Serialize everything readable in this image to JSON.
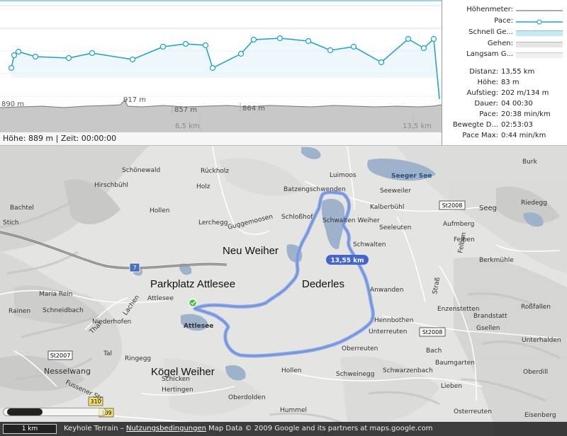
{
  "profile": {
    "elevation_labels": [
      "890 m",
      "917 m",
      "857 m",
      "864 m"
    ],
    "distance_labels": [
      "6,5 km",
      "13,5 km"
    ],
    "status": "Höhe: 889 m | Zeit: 00:00:00",
    "colors": {
      "pace": "#1ea0c8",
      "pace_fill": "#c8e8f4",
      "elevation": "#888888"
    }
  },
  "legend": {
    "items": [
      {
        "label": "Höhenmeter:",
        "swatch": "line-gray"
      },
      {
        "label": "Pace:",
        "swatch": "line-dot-blue"
      },
      {
        "label": "Schnell Ge...",
        "swatch": "fill-lightblue"
      },
      {
        "label": "Gehen:",
        "swatch": "fill-gray"
      },
      {
        "label": "Langsam G...",
        "swatch": "fill-lightgray"
      }
    ]
  },
  "stats": [
    {
      "key": "Distanz:",
      "value": "13,55 km"
    },
    {
      "key": "Höhe:",
      "value": "83 m"
    },
    {
      "key": "Aufstieg:",
      "value": "202 m/134 m"
    },
    {
      "key": "Dauer:",
      "value": "04 00:30"
    },
    {
      "key": "Pace:",
      "value": "20:38 min/km"
    },
    {
      "key": "Bewegte D...",
      "value": "02:53:03"
    },
    {
      "key": "Pace Max:",
      "value": "0:44 min/km"
    }
  ],
  "map": {
    "places": {
      "schoenewald": "Schönewald",
      "rueckholz": "Rückholz",
      "hirschbuehl": "Hirschbühl",
      "holz": "Holz",
      "luimoos": "Luimoos",
      "seeger_see": "Seeger See",
      "burk": "Burk",
      "batzengschwenden": "Batzengschwenden",
      "seeweiler": "Seeweiler",
      "bachtel": "Bachtel",
      "hollen": "Hollen",
      "kalberbuehl": "Kalberbühl",
      "seeg": "Seeg",
      "riedegg": "Riedegg",
      "stich": "Stich",
      "lerchegg": "Lerchegg",
      "guggemoosen": "Guggemoosen",
      "schlosshof": "Schloßhof",
      "schwarzen_weiher": "Schwalten Weiher",
      "aufmberg": "Aufmberg",
      "seeleuten": "Seeleuten",
      "felben": "Felben",
      "schwalten": "Schwalten",
      "neu_weiher": "Neu Weiher",
      "berkmuehle": "Berkmühle",
      "maria_rein": "Maria Rein",
      "parkplatz": "Parkplatz Attlesee",
      "dederles": "Dederles",
      "anwanden": "Anwanden",
      "rainen": "Rainen",
      "schneidbach": "Schneidbach",
      "attlesee_road": "Attlesee",
      "lachen": "Lachen",
      "enzenstetten": "Enzenstetten",
      "rossfallen": "Roßfallen",
      "brandstatt": "Brandstatt",
      "niederhofen": "Niederhofen",
      "attlesee": "Attlesee",
      "hennbothen": "Hennbothen",
      "unterreuten": "Unterreuten",
      "gsellen": "Gsellen",
      "thal": "Thal",
      "unterhalden": "Unterhalden",
      "tal": "Tal",
      "oberreuten": "Oberreuten",
      "bach": "Bach",
      "ringegg": "Ringegg",
      "baumgarten": "Baumgarten",
      "nesselwang": "Nesselwang",
      "koegel_weiher": "Kögel Weiher",
      "hollen2": "Hollen",
      "schwenegg": "Schweinegg",
      "schwarzenbach": "Schwarzenbach",
      "oberdill": "Oberdill",
      "schicken": "Schicken",
      "lieben": "Lieben",
      "fuessener_str": "Fussener Str.",
      "hertingen": "Hertingen",
      "oberdolden": "Oberdolden",
      "hummel": "Hummel",
      "osterreuten": "Osterreuten",
      "eisenberg": "Eisenberg",
      "strass": "Straß",
      "felben_road": "Felben"
    },
    "roads": {
      "st2008a": "St2008",
      "st2008b": "St2008",
      "st2007": "St2007",
      "r7": "7",
      "r310": "310",
      "r309": "309"
    },
    "route_distance": "13,55 km",
    "route_color": "#8aa6e6"
  },
  "footer": {
    "scale": "1 km",
    "terrain": "Keyhole Terrain – ",
    "terms_link": "Nutzungsbedingungen",
    "attribution": " Map Data © 2009 Google and its partners at maps.google.com"
  }
}
